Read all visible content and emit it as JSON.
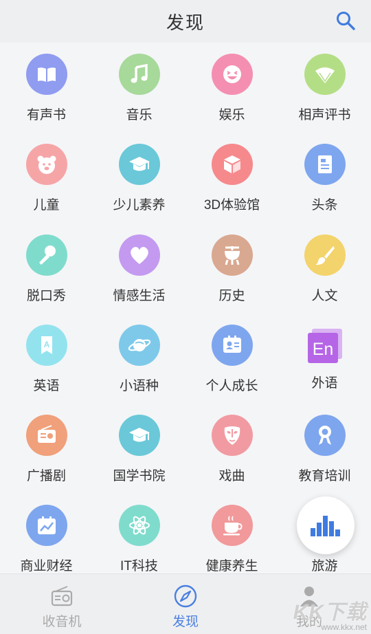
{
  "header": {
    "title": "发现"
  },
  "categories": [
    {
      "label": "有声书",
      "icon": "book-icon",
      "color": "#8f9cf0"
    },
    {
      "label": "音乐",
      "icon": "music-note-icon",
      "color": "#a7d99a"
    },
    {
      "label": "娱乐",
      "icon": "smile-icon",
      "color": "#f48fb1"
    },
    {
      "label": "相声评书",
      "icon": "fan-icon",
      "color": "#b4de86"
    },
    {
      "label": "儿童",
      "icon": "bear-icon",
      "color": "#f6a5a7"
    },
    {
      "label": "少儿素养",
      "icon": "graduation-cap-icon",
      "color": "#6ac8d8"
    },
    {
      "label": "3D体验馆",
      "icon": "cube-icon",
      "color": "#f6898c"
    },
    {
      "label": "头条",
      "icon": "newspaper-icon",
      "color": "#7ea6ee"
    },
    {
      "label": "脱口秀",
      "icon": "microphone-icon",
      "color": "#7fdccd"
    },
    {
      "label": "情感生活",
      "icon": "heart-icon",
      "color": "#c39af0"
    },
    {
      "label": "历史",
      "icon": "bronze-vessel-icon",
      "color": "#d9a890"
    },
    {
      "label": "人文",
      "icon": "brush-icon",
      "color": "#f3d36b"
    },
    {
      "label": "英语",
      "icon": "letter-a-icon",
      "color": "#93e3ee"
    },
    {
      "label": "小语种",
      "icon": "planet-icon",
      "color": "#7ec9ea"
    },
    {
      "label": "个人成长",
      "icon": "id-card-icon",
      "color": "#7ea6ee"
    },
    {
      "label": "外语",
      "icon": "en-icon",
      "color": "#b565e6"
    },
    {
      "label": "广播剧",
      "icon": "radio-icon",
      "color": "#f0a07a"
    },
    {
      "label": "国学书院",
      "icon": "graduation-cap-icon",
      "color": "#6ac8d8"
    },
    {
      "label": "戏曲",
      "icon": "opera-mask-icon",
      "color": "#f19aa2"
    },
    {
      "label": "教育培训",
      "icon": "award-ribbon-icon",
      "color": "#7ea6ee"
    },
    {
      "label": "商业财经",
      "icon": "chart-calendar-icon",
      "color": "#7ea6ee"
    },
    {
      "label": "IT科技",
      "icon": "atom-icon",
      "color": "#7fdccd"
    },
    {
      "label": "健康养生",
      "icon": "tea-cup-icon",
      "color": "#f1999b"
    },
    {
      "label": "旅游",
      "icon": "travel-icon",
      "color": "#7ea6ee"
    }
  ],
  "en_icon_text": "En",
  "tabs": [
    {
      "label": "收音机",
      "icon": "radio-icon",
      "active": false
    },
    {
      "label": "发现",
      "icon": "compass-icon",
      "active": true
    },
    {
      "label": "我的",
      "icon": "user-icon",
      "active": false
    }
  ],
  "watermark": {
    "brand": "KK下载",
    "url": "www.kkx.net"
  },
  "colors": {
    "accent": "#4a7fe0",
    "inactive": "#aaaaaa"
  }
}
